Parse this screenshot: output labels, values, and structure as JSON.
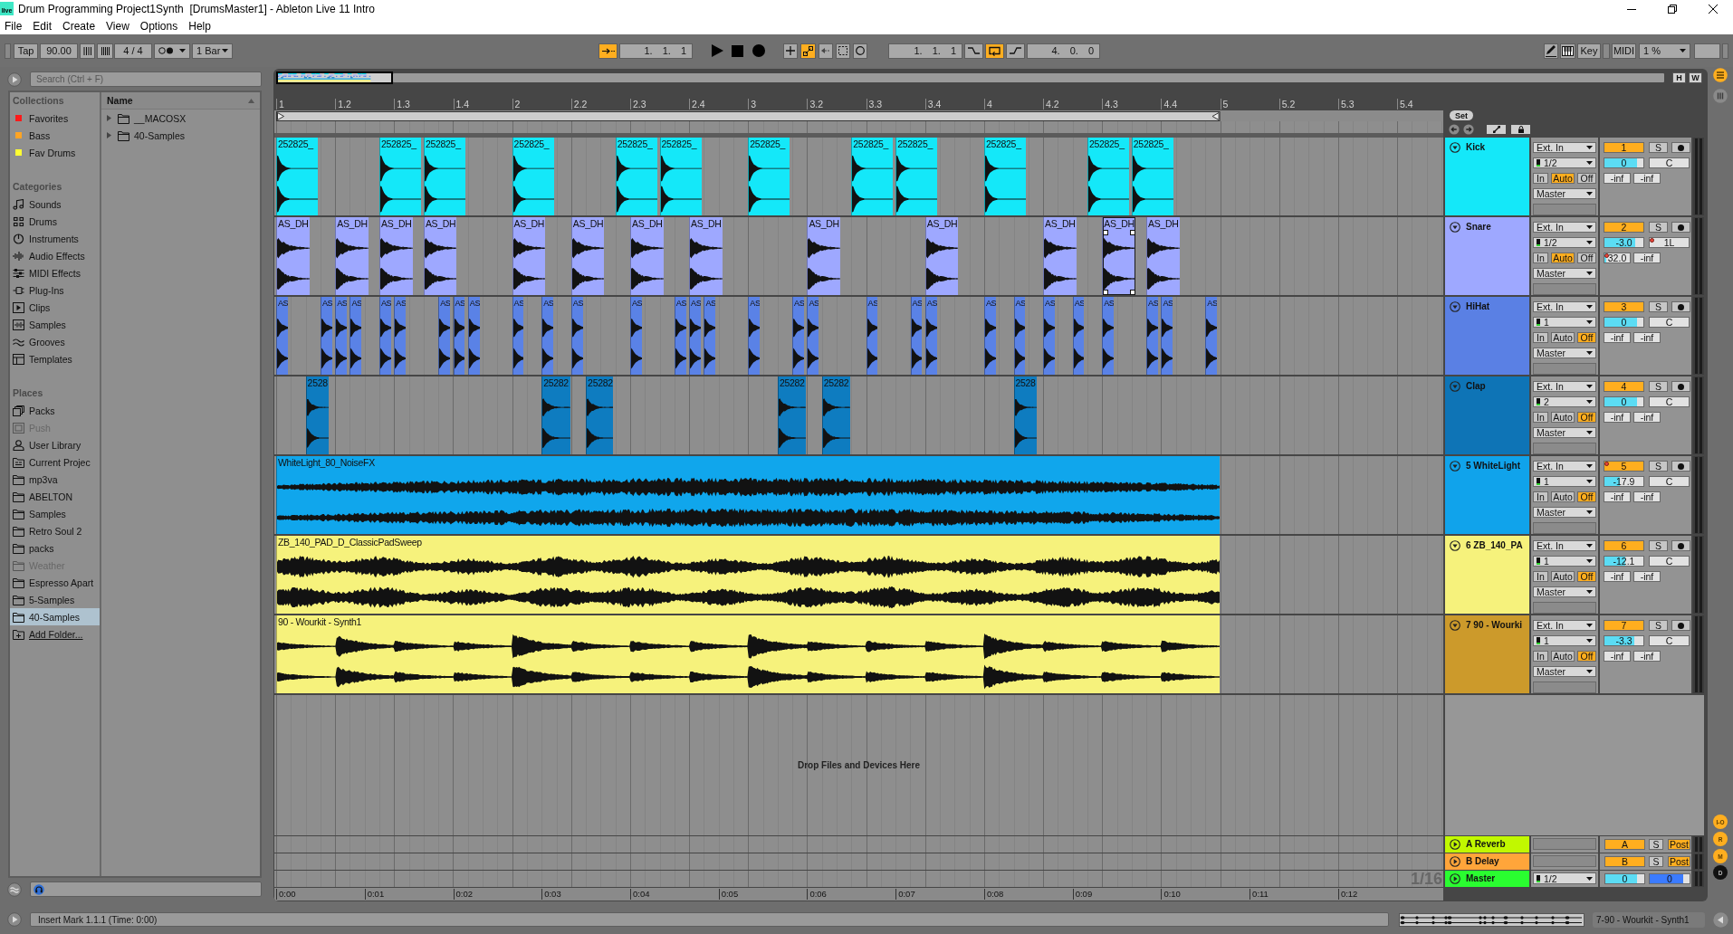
{
  "window": {
    "logo": "live",
    "title": "Drum Programming Project1Synth  [DrumsMaster1] - Ableton Live 11 Intro"
  },
  "menu": [
    {
      "label": "File"
    },
    {
      "label": "Edit"
    },
    {
      "label": "Create"
    },
    {
      "label": "View"
    },
    {
      "label": "Options"
    },
    {
      "label": "Help"
    }
  ],
  "control_bar": {
    "tap": "Tap",
    "tempo": "90.00",
    "signature": "4 / 4",
    "quantization": "1 Bar",
    "follow": true,
    "position": "1. 1. 1",
    "overdub": false,
    "automation_arm": true,
    "loop_start": "1. 1. 1",
    "punch_in": false,
    "loop": true,
    "punch_out": false,
    "loop_length": "4. 0. 0",
    "key": "Key",
    "midi": "MIDI",
    "cpu": "1 %"
  },
  "browser": {
    "search": {
      "placeholder": "Search (Ctrl + F)"
    },
    "sections": [
      {
        "title": "Collections",
        "items": [
          {
            "label": "Favorites",
            "kind": "tag",
            "color": "#ff1a1a",
            "selected": false
          },
          {
            "label": "Bass",
            "kind": "tag",
            "color": "#ffa424",
            "selected": false
          },
          {
            "label": "Fav Drums",
            "kind": "tag",
            "color": "#ffff33",
            "selected": false
          }
        ]
      },
      {
        "title": "Categories",
        "items": [
          {
            "label": "Sounds",
            "kind": "sounds",
            "selected": false
          },
          {
            "label": "Drums",
            "kind": "drums",
            "selected": false
          },
          {
            "label": "Instruments",
            "kind": "instruments",
            "selected": false
          },
          {
            "label": "Audio Effects",
            "kind": "audiofx",
            "selected": false
          },
          {
            "label": "MIDI Effects",
            "kind": "midifx",
            "selected": false
          },
          {
            "label": "Plug-Ins",
            "kind": "plugins",
            "selected": false
          },
          {
            "label": "Clips",
            "kind": "clips",
            "selected": false
          },
          {
            "label": "Samples",
            "kind": "samples",
            "selected": false
          },
          {
            "label": "Grooves",
            "kind": "grooves",
            "selected": false
          },
          {
            "label": "Templates",
            "kind": "templates",
            "selected": false
          }
        ]
      },
      {
        "title": "Places",
        "items": [
          {
            "label": "Packs",
            "kind": "packs",
            "selected": false,
            "disabled": false
          },
          {
            "label": "Push",
            "kind": "push",
            "selected": false,
            "disabled": true
          },
          {
            "label": "User Library",
            "kind": "library",
            "selected": false,
            "disabled": false
          },
          {
            "label": "Current Projec",
            "kind": "project",
            "selected": false,
            "disabled": false
          },
          {
            "label": "mp3va",
            "kind": "folder",
            "selected": false,
            "disabled": false
          },
          {
            "label": "ABELTON",
            "kind": "folder",
            "selected": false,
            "disabled": false
          },
          {
            "label": "Samples",
            "kind": "folder",
            "selected": false,
            "disabled": false
          },
          {
            "label": "Retro Soul 2",
            "kind": "folder",
            "selected": false,
            "disabled": false
          },
          {
            "label": "packs",
            "kind": "folder",
            "selected": false,
            "disabled": false
          },
          {
            "label": "Weather",
            "kind": "folder",
            "selected": false,
            "disabled": true
          },
          {
            "label": "Espresso Apart",
            "kind": "folder",
            "selected": false,
            "disabled": false
          },
          {
            "label": "5-Samples",
            "kind": "folder",
            "selected": false,
            "disabled": false
          },
          {
            "label": "40-Samples",
            "kind": "folder",
            "selected": true,
            "disabled": false
          },
          {
            "label": "Add Folder...",
            "kind": "add",
            "selected": false,
            "disabled": false
          }
        ]
      }
    ],
    "list": {
      "header": "Name",
      "items": [
        {
          "label": "__MACOSX",
          "expanded": false
        },
        {
          "label": "40-Samples",
          "expanded": false
        }
      ]
    }
  },
  "arrangement": {
    "overview": {
      "buttons": [
        "H",
        "W"
      ]
    },
    "ruler": [
      "1",
      "1.2",
      "1.3",
      "1.4",
      "2",
      "2.2",
      "2.3",
      "2.4",
      "3",
      "3.2",
      "3.3",
      "3.4",
      "4",
      "4.2",
      "4.3",
      "4.4",
      "5",
      "5.2",
      "5.3",
      "5.4"
    ],
    "set_button": "Set",
    "tracks": [
      {
        "name": "Kick",
        "color": "#14e8f9",
        "expanded": true,
        "clips": [
          {
            "name": "252825_",
            "color": "#14e8f9",
            "selected": false
          },
          {
            "name": "252825_",
            "color": "#14e8f9",
            "selected": false
          },
          {
            "name": "252825_",
            "color": "#14e8f9",
            "selected": false
          },
          {
            "name": "252825_",
            "color": "#14e8f9",
            "selected": false
          },
          {
            "name": "252825_",
            "color": "#14e8f9",
            "selected": false
          },
          {
            "name": "252825_",
            "color": "#14e8f9",
            "selected": false
          },
          {
            "name": "252825_",
            "color": "#14e8f9",
            "selected": false
          },
          {
            "name": "252825_",
            "color": "#14e8f9",
            "selected": false
          },
          {
            "name": "252825_",
            "color": "#14e8f9",
            "selected": false
          },
          {
            "name": "252825_",
            "color": "#14e8f9",
            "selected": false
          },
          {
            "name": "252825_",
            "color": "#14e8f9",
            "selected": false
          },
          {
            "name": "252825_",
            "color": "#14e8f9",
            "selected": false
          }
        ],
        "input": "Ext. In",
        "channel": "1/2",
        "monitor": [
          {
            "label": "In",
            "selected": false
          },
          {
            "label": "Auto",
            "selected": true
          },
          {
            "label": "Off",
            "selected": false
          }
        ],
        "output": "Master",
        "number": {
          "text": "1",
          "on": true,
          "automated": false
        },
        "solo": {
          "text": "S",
          "on": false
        },
        "armed": false,
        "volume": {
          "text": "0",
          "level": 0.84
        },
        "pan": {
          "text": "C",
          "automated": false
        },
        "sends": [
          {
            "text": "-inf",
            "automated": false
          },
          {
            "text": "-inf",
            "automated": false
          }
        ]
      },
      {
        "name": "Snare",
        "color": "#9ea8ff",
        "expanded": true,
        "clips": [
          {
            "name": "AS_DH",
            "color": "#9ea8ff",
            "selected": false
          },
          {
            "name": "AS_DH",
            "color": "#9ea8ff",
            "selected": false
          },
          {
            "name": "AS_DH",
            "color": "#9ea8ff",
            "selected": false
          },
          {
            "name": "AS_DH",
            "color": "#9ea8ff",
            "selected": false
          },
          {
            "name": "AS_DH",
            "color": "#9ea8ff",
            "selected": false
          },
          {
            "name": "AS_DH",
            "color": "#9ea8ff",
            "selected": false
          },
          {
            "name": "AS_DH",
            "color": "#9ea8ff",
            "selected": false
          },
          {
            "name": "AS_DH",
            "color": "#9ea8ff",
            "selected": false
          },
          {
            "name": "AS_DH",
            "color": "#9ea8ff",
            "selected": false
          },
          {
            "name": "AS_DH",
            "color": "#9ea8ff",
            "selected": false
          },
          {
            "name": "AS_DH",
            "color": "#9ea8ff",
            "selected": false
          },
          {
            "name": "AS_DH",
            "color": "#9ea8ff",
            "selected": true
          },
          {
            "name": "AS_DH",
            "color": "#9ea8ff",
            "selected": false
          }
        ],
        "input": "Ext. In",
        "channel": "1/2",
        "monitor": [
          {
            "label": "In",
            "selected": false
          },
          {
            "label": "Auto",
            "selected": true
          },
          {
            "label": "Off",
            "selected": false
          }
        ],
        "output": "Master",
        "number": {
          "text": "2",
          "on": true,
          "automated": false
        },
        "solo": {
          "text": "S",
          "on": false
        },
        "armed": false,
        "volume": {
          "text": "-3.0",
          "level": 0.78
        },
        "pan": {
          "text": "1L",
          "automated": true
        },
        "sends": [
          {
            "text": "32.0",
            "level": 0.07,
            "automated": true
          },
          {
            "text": "-inf",
            "automated": false
          }
        ]
      },
      {
        "name": "HiHat",
        "color": "#5a80e4",
        "expanded": true,
        "clips": [
          {
            "name": "AS",
            "color": "#5a82e6",
            "selected": false
          },
          {
            "name": "AS",
            "color": "#5a82e6",
            "selected": false
          },
          {
            "name": "AS",
            "color": "#5a82e6",
            "selected": false
          },
          {
            "name": "AS",
            "color": "#5a82e6",
            "selected": false
          },
          {
            "name": "AS",
            "color": "#5a82e6",
            "selected": false
          },
          {
            "name": "AS",
            "color": "#5a82e6",
            "selected": false
          },
          {
            "name": "AS",
            "color": "#5a82e6",
            "selected": false
          },
          {
            "name": "AS",
            "color": "#5a82e6",
            "selected": false
          },
          {
            "name": "AS",
            "color": "#5a82e6",
            "selected": false
          },
          {
            "name": "AS",
            "color": "#5a82e6",
            "selected": false
          },
          {
            "name": "AS",
            "color": "#5a82e6",
            "selected": false
          },
          {
            "name": "AS",
            "color": "#5a82e6",
            "selected": false
          },
          {
            "name": "AS",
            "color": "#5a82e6",
            "selected": false
          },
          {
            "name": "AS",
            "color": "#5a82e6",
            "selected": false
          },
          {
            "name": "AS",
            "color": "#5a82e6",
            "selected": false
          },
          {
            "name": "AS",
            "color": "#5a82e6",
            "selected": false
          },
          {
            "name": "AS",
            "color": "#5a82e6",
            "selected": false
          },
          {
            "name": "AS",
            "color": "#5a82e6",
            "selected": false
          },
          {
            "name": "AS",
            "color": "#5a82e6",
            "selected": false
          },
          {
            "name": "AS",
            "color": "#5a82e6",
            "selected": false
          },
          {
            "name": "AS",
            "color": "#5a82e6",
            "selected": false
          },
          {
            "name": "AS",
            "color": "#5a82e6",
            "selected": false
          },
          {
            "name": "AS",
            "color": "#5a82e6",
            "selected": false
          },
          {
            "name": "AS",
            "color": "#5a82e6",
            "selected": false
          },
          {
            "name": "AS",
            "color": "#5a82e6",
            "selected": false
          },
          {
            "name": "AS",
            "color": "#5a82e6",
            "selected": false
          },
          {
            "name": "AS",
            "color": "#5a82e6",
            "selected": false
          },
          {
            "name": "AS",
            "color": "#5a82e6",
            "selected": false
          },
          {
            "name": "AS",
            "color": "#5a82e6",
            "selected": false
          },
          {
            "name": "AS",
            "color": "#5a82e6",
            "selected": false
          }
        ],
        "input": "Ext. In",
        "channel": "1",
        "monitor": [
          {
            "label": "In",
            "selected": false
          },
          {
            "label": "Auto",
            "selected": false
          },
          {
            "label": "Off",
            "selected": true
          }
        ],
        "output": "Master",
        "number": {
          "text": "3",
          "on": true,
          "automated": false
        },
        "solo": {
          "text": "S",
          "on": false
        },
        "armed": false,
        "volume": {
          "text": "0",
          "level": 0.84
        },
        "pan": {
          "text": "C",
          "automated": false
        },
        "sends": [
          {
            "text": "-inf",
            "automated": false
          },
          {
            "text": "-inf",
            "automated": false
          }
        ]
      },
      {
        "name": "Clap",
        "color": "#0e74b6",
        "expanded": true,
        "clips": [
          {
            "name": "2528",
            "color": "#0e7cc0",
            "selected": false
          },
          {
            "name": "25282",
            "color": "#0e7cc0",
            "selected": false
          },
          {
            "name": "25282",
            "color": "#0e7cc0",
            "selected": false
          },
          {
            "name": "25282",
            "color": "#0e7cc0",
            "selected": false
          },
          {
            "name": "25282",
            "color": "#0e7cc0",
            "selected": false
          },
          {
            "name": "2528",
            "color": "#0e7cc0",
            "selected": false
          }
        ],
        "input": "Ext. In",
        "channel": "2",
        "monitor": [
          {
            "label": "In",
            "selected": false
          },
          {
            "label": "Auto",
            "selected": false
          },
          {
            "label": "Off",
            "selected": true
          }
        ],
        "output": "Master",
        "number": {
          "text": "4",
          "on": true,
          "automated": false
        },
        "solo": {
          "text": "S",
          "on": false
        },
        "armed": false,
        "volume": {
          "text": "0",
          "level": 0.84
        },
        "pan": {
          "text": "C",
          "automated": false
        },
        "sends": [
          {
            "text": "-inf",
            "automated": false
          },
          {
            "text": "-inf",
            "automated": false
          }
        ]
      },
      {
        "name": "5 WhiteLight",
        "color": "#10a3eb",
        "expanded": true,
        "clips": [
          {
            "name": "WhiteLight_80_NoiseFX",
            "color": "#10a6ec",
            "selected": false
          }
        ],
        "input": "Ext. In",
        "channel": "1",
        "monitor": [
          {
            "label": "In",
            "selected": false
          },
          {
            "label": "Auto",
            "selected": false
          },
          {
            "label": "Off",
            "selected": true
          }
        ],
        "output": "Master",
        "number": {
          "text": "5",
          "on": true,
          "automated": true
        },
        "solo": {
          "text": "S",
          "on": false
        },
        "armed": false,
        "volume": {
          "text": "-17.9",
          "level": 0.4
        },
        "pan": {
          "text": "C",
          "automated": false
        },
        "sends": [
          {
            "text": "-inf",
            "automated": false
          },
          {
            "text": "-inf",
            "automated": false
          }
        ]
      },
      {
        "name": "6 ZB_140_PA",
        "color": "#f6f27c",
        "expanded": true,
        "clips": [
          {
            "name": "ZB_140_PAD_D_ClassicPadSweep",
            "color": "#f6f27c",
            "selected": false
          }
        ],
        "input": "Ext. In",
        "channel": "1",
        "monitor": [
          {
            "label": "In",
            "selected": false
          },
          {
            "label": "Auto",
            "selected": false
          },
          {
            "label": "Off",
            "selected": true
          }
        ],
        "output": "Master",
        "number": {
          "text": "6",
          "on": true,
          "automated": false
        },
        "solo": {
          "text": "S",
          "on": false
        },
        "armed": false,
        "volume": {
          "text": "-12.1",
          "level": 0.53
        },
        "pan": {
          "text": "C",
          "automated": false
        },
        "sends": [
          {
            "text": "-inf",
            "automated": false
          },
          {
            "text": "-inf",
            "automated": false
          }
        ]
      },
      {
        "name": "7 90 - Wourki",
        "color": "#cc9a2b",
        "expanded": true,
        "clips": [
          {
            "name": "90 - Wourkit - Synth1",
            "color": "#f6f27c",
            "selected": false
          }
        ],
        "input": "Ext. In",
        "channel": "1",
        "monitor": [
          {
            "label": "In",
            "selected": false
          },
          {
            "label": "Auto",
            "selected": false
          },
          {
            "label": "Off",
            "selected": true
          }
        ],
        "output": "Master",
        "number": {
          "text": "7",
          "on": true,
          "automated": false
        },
        "solo": {
          "text": "S",
          "on": false
        },
        "armed": false,
        "volume": {
          "text": "-3.3",
          "level": 0.77
        },
        "pan": {
          "text": "C",
          "automated": false
        },
        "sends": [
          {
            "text": "-inf",
            "automated": false
          },
          {
            "text": "-inf",
            "automated": false
          }
        ]
      }
    ],
    "drop_hint": "Drop Files and Devices Here",
    "returns": [
      {
        "name": "A Reverb",
        "color": "#c1f800",
        "expanded": false,
        "letter": {
          "text": "A",
          "on": true
        },
        "solo": {
          "text": "S",
          "on": false
        },
        "post": {
          "text": "Post",
          "on": true
        }
      },
      {
        "name": "B Delay",
        "color": "#ffa53a",
        "expanded": false,
        "letter": {
          "text": "B",
          "on": true
        },
        "solo": {
          "text": "S",
          "on": false
        },
        "post": {
          "text": "Post",
          "on": true
        }
      }
    ],
    "master": {
      "name": "Master",
      "color": "#2afd30",
      "expanded": false,
      "output": "1/2",
      "volume": {
        "text": "0",
        "level": 0.81
      },
      "cue": {
        "text": "0",
        "level": 0.83
      }
    },
    "grid": "1/16",
    "time_ruler": [
      "0:00",
      "0:01",
      "0:02",
      "0:03",
      "0:04",
      "0:05",
      "0:06",
      "0:07",
      "0:08",
      "0:09",
      "0:10",
      "0:11",
      "0:12"
    ]
  },
  "side_buttons": [
    {
      "label": "I-O",
      "on": true
    },
    {
      "label": "R",
      "on": true
    },
    {
      "label": "M",
      "on": true
    },
    {
      "label": "D",
      "on": false
    }
  ],
  "status_bar": {
    "message": "Insert Mark 1.1.1 (Time: 0:00)",
    "clip": "7-90 - Wourkit - Synth1"
  }
}
